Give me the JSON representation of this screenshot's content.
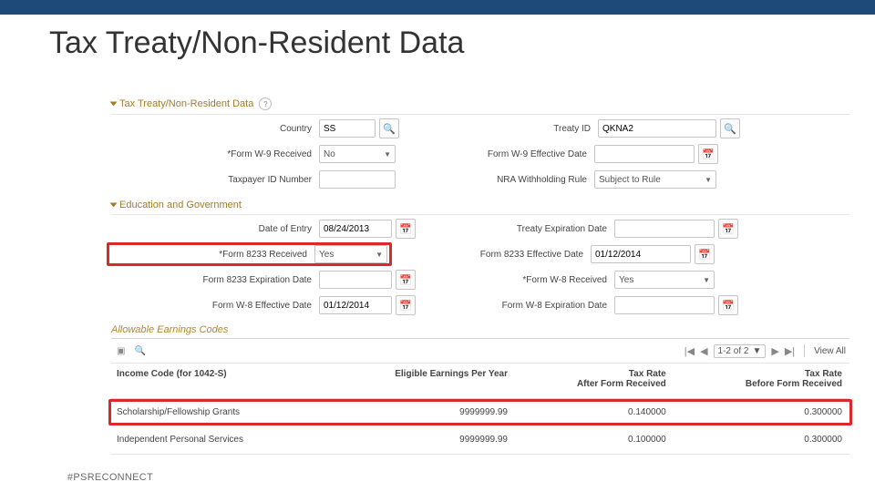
{
  "page": {
    "title": "Tax Treaty/Non-Resident Data",
    "footer": "#PSRECONNECT"
  },
  "sections": {
    "main": {
      "header": "Tax Treaty/Non-Resident Data",
      "left": {
        "country_label": "Country",
        "country_value": "SS",
        "w9_label": "*Form W-9 Received",
        "w9_value": "No",
        "tpid_label": "Taxpayer ID Number",
        "tpid_value": ""
      },
      "right": {
        "treaty_label": "Treaty ID",
        "treaty_value": "QKNA2",
        "w9eff_label": "Form W-9 Effective Date",
        "w9eff_value": "",
        "nra_label": "NRA Withholding Rule",
        "nra_value": "Subject to Rule"
      }
    },
    "edu": {
      "header": "Education and Government",
      "left": {
        "doe_label": "Date of Entry",
        "doe_value": "08/24/2013",
        "f8233r_label": "*Form 8233 Received",
        "f8233r_value": "Yes",
        "f8233exp_label": "Form 8233 Expiration Date",
        "f8233exp_value": "",
        "w8eff_label": "Form W-8 Effective Date",
        "w8eff_value": "01/12/2014"
      },
      "right": {
        "texp_label": "Treaty Expiration Date",
        "texp_value": "",
        "f8233eff_label": "Form 8233 Effective Date",
        "f8233eff_value": "01/12/2014",
        "w8r_label": "*Form W-8 Received",
        "w8r_value": "Yes",
        "w8exp_label": "Form W-8 Expiration Date",
        "w8exp_value": ""
      }
    }
  },
  "grid": {
    "title": "Allowable Earnings Codes",
    "range": "1-2 of 2",
    "viewall": "View All",
    "headers": {
      "c1": "Income Code (for 1042-S)",
      "c2": "Eligible Earnings Per Year",
      "c3": "Tax Rate\nAfter Form Received",
      "c3a": "Tax Rate",
      "c3b": "After Form Received",
      "c4a": "Tax Rate",
      "c4b": "Before Form Received"
    },
    "rows": [
      {
        "code": "Scholarship/Fellowship Grants",
        "eligible": "9999999.99",
        "after": "0.140000",
        "before": "0.300000"
      },
      {
        "code": "Independent Personal Services",
        "eligible": "9999999.99",
        "after": "0.100000",
        "before": "0.300000"
      }
    ]
  }
}
